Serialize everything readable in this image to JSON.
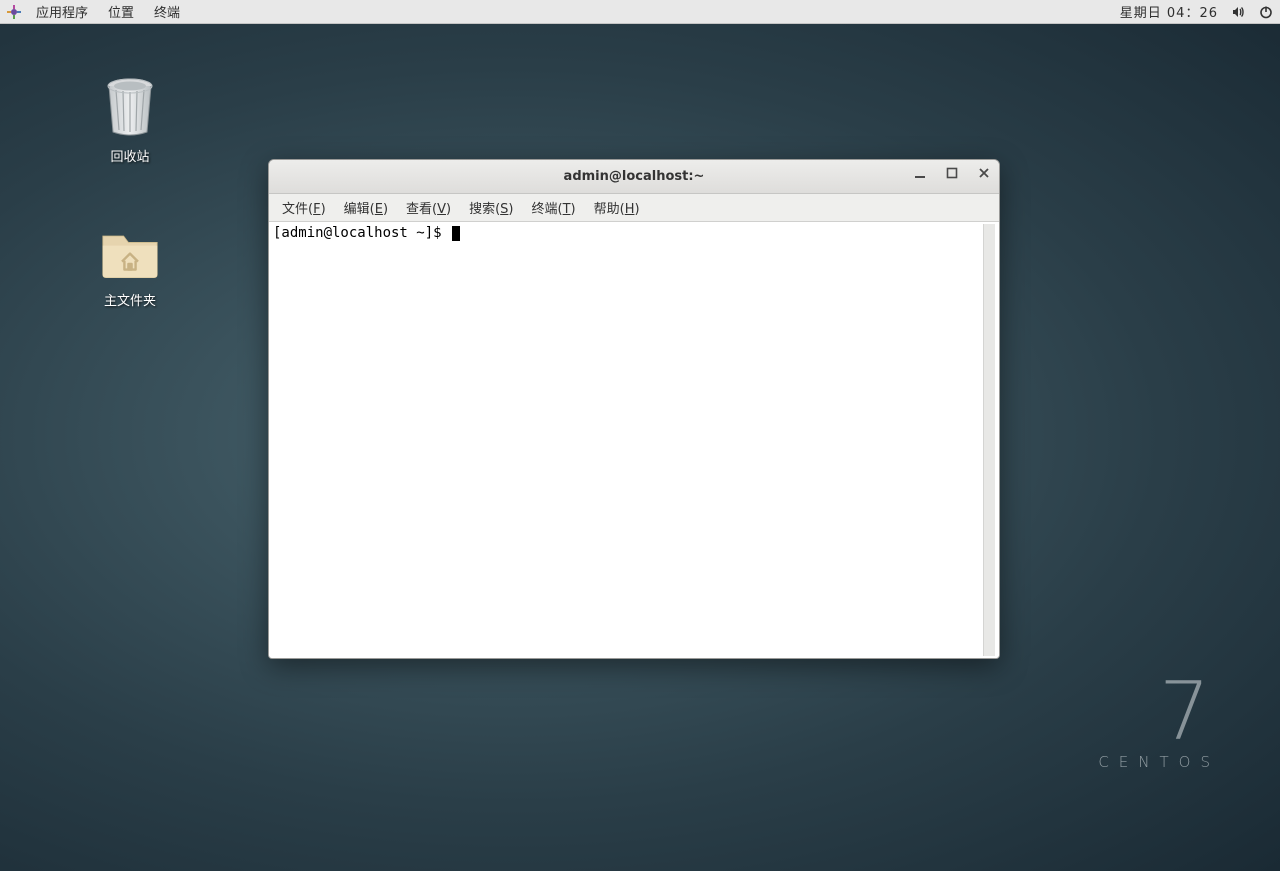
{
  "panel": {
    "applications": "应用程序",
    "places": "位置",
    "terminal": "终端",
    "clock": "星期日 04：26"
  },
  "desktop": {
    "trash_label": "回收站",
    "home_label": "主文件夹"
  },
  "window": {
    "title": "admin@localhost:~",
    "menus": {
      "file": {
        "pre": "文件(",
        "key": "F",
        "post": ")"
      },
      "edit": {
        "pre": "编辑(",
        "key": "E",
        "post": ")"
      },
      "view": {
        "pre": "查看(",
        "key": "V",
        "post": ")"
      },
      "search": {
        "pre": "搜索(",
        "key": "S",
        "post": ")"
      },
      "terminal": {
        "pre": "终端(",
        "key": "T",
        "post": ")"
      },
      "help": {
        "pre": "帮助(",
        "key": "H",
        "post": ")"
      }
    },
    "prompt": "[admin@localhost ~]$ "
  },
  "branding": {
    "version": "7",
    "name": "CENTOS"
  }
}
